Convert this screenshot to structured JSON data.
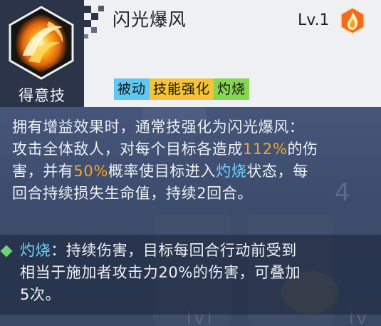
{
  "skill": {
    "name": "闪光爆风",
    "level": "Lv.1",
    "type_label": "得意技",
    "icon": "flash-blast-icon",
    "badge_icon": "fire-badge-icon"
  },
  "tags": [
    {
      "label": "被动",
      "color": "#5ec8f0"
    },
    {
      "label": "技能强化",
      "color": "#f5c335"
    },
    {
      "label": "灼烧",
      "color": "#86d64e"
    }
  ],
  "description": {
    "line1": "拥有增益效果时，通常技强化为闪光爆风：",
    "line2_a": "攻击全体敌人，对每个目标各造成",
    "line2_pct": "112%",
    "line2_b": "的伤",
    "line3_a": "害，并有",
    "line3_pct": "50%",
    "line3_b": "概率使目标进入",
    "line3_kw": "灼烧",
    "line3_c": "状态，每",
    "line4": "回合持续损失生命值，持续2回合。"
  },
  "status_note": {
    "keyword": "灼烧",
    "line1_rest": "：持续伤害，目标每回合行动前受到",
    "line2": "相当于施加者攻击力20%的伤害，可叠加",
    "line3": "5次。"
  },
  "colors": {
    "highlight_value": "#f5a623",
    "keyword": "#6fd3ff",
    "bullet": "#6fd37a"
  }
}
